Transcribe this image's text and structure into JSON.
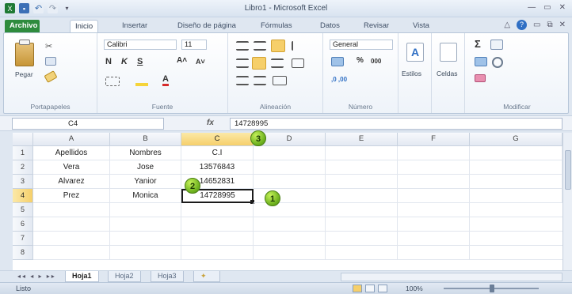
{
  "window": {
    "title": "Libro1 - Microsoft Excel",
    "controls": [
      "—",
      "▭",
      "✕"
    ]
  },
  "ribbon_tabs": {
    "file": "Archivo",
    "home": "Inicio",
    "insert": "Insertar",
    "page_layout": "Diseño de página",
    "formulas": "Fórmulas",
    "data": "Datos",
    "review": "Revisar",
    "view": "Vista"
  },
  "ribbon": {
    "clipboard": {
      "label": "Portapapeles",
      "paste": "Pegar"
    },
    "font": {
      "label": "Fuente",
      "name": "Calibri",
      "size": "11",
      "bold": "N",
      "italic": "K",
      "underline": "S",
      "grow": "A˄",
      "shrink": "A˅",
      "color": "A"
    },
    "alignment": {
      "label": "Alineación"
    },
    "number": {
      "label": "Número",
      "format": "General",
      "percent": "%",
      "thousands": "000",
      "inc": ",0 ,00"
    },
    "styles": {
      "label": "Estilos"
    },
    "cells": {
      "label": "Celdas"
    },
    "editing": {
      "label": "Modificar",
      "sum": "Σ"
    }
  },
  "formula_bar": {
    "name_box": "C4",
    "fx": "fx",
    "content": "14728995"
  },
  "columns": [
    "A",
    "B",
    "C",
    "D",
    "E",
    "F",
    "G"
  ],
  "rows": [
    "1",
    "2",
    "3",
    "4",
    "5",
    "6",
    "7",
    "8"
  ],
  "cells": {
    "A1": "Apellidos",
    "B1": "Nombres",
    "C1": "C.I",
    "A2": "Vera",
    "B2": "Jose",
    "C2": "13576843",
    "A3": "Alvarez",
    "B3": "Yanior",
    "C3": "14652831",
    "A4": "Prez",
    "B4": "Monica",
    "C4": "14728995"
  },
  "selected_cell": "C4",
  "sheet_tabs": [
    "Hoja1",
    "Hoja2",
    "Hoja3"
  ],
  "status": {
    "ready": "Listo",
    "zoom": "100%"
  },
  "callouts": [
    "1",
    "2",
    "3"
  ],
  "colors": {
    "file_tab": "#2e8b3d",
    "selection_header": "#f6cf6a",
    "callout": "#6fb21f"
  }
}
